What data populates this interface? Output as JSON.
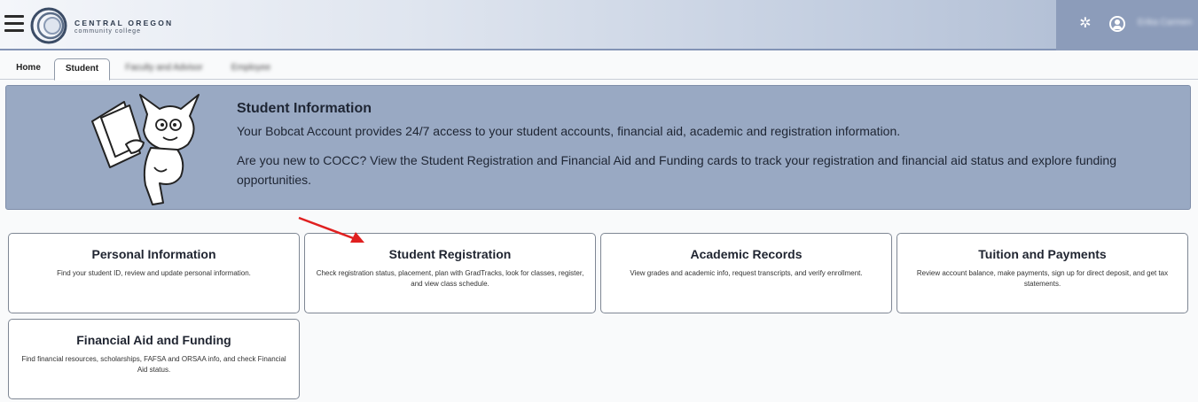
{
  "header": {
    "logo_name": "CENTRAL OREGON",
    "logo_sub": "community college",
    "user_name": "Erika Carmen"
  },
  "tabs": [
    {
      "label": "Home"
    },
    {
      "label": "Student"
    },
    {
      "label": "Faculty and Advisor"
    },
    {
      "label": "Employee"
    }
  ],
  "banner": {
    "title": "Student Information",
    "line1": "Your Bobcat Account provides 24/7 access to your student accounts, financial aid, academic and registration information.",
    "line2": "Are you new to COCC? View the Student Registration and Financial Aid and Funding cards to track your registration and financial aid status and explore funding opportunities."
  },
  "cards": [
    {
      "title": "Personal Information",
      "desc": "Find your student ID, review and update personal information."
    },
    {
      "title": "Student Registration",
      "desc": "Check registration status, placement, plan with GradTracks, look for classes, register, and view class schedule."
    },
    {
      "title": "Academic Records",
      "desc": "View grades and academic info, request transcripts, and verify enrollment."
    },
    {
      "title": "Tuition and Payments",
      "desc": "Review account balance, make payments, sign up for direct deposit, and get tax statements."
    },
    {
      "title": "Financial Aid and Funding",
      "desc": "Find financial resources, scholarships, FAFSA and ORSAA info, and check Financial Aid status."
    }
  ],
  "colors": {
    "banner_bg": "#99a9c3",
    "annotation_arrow": "#e02020"
  }
}
